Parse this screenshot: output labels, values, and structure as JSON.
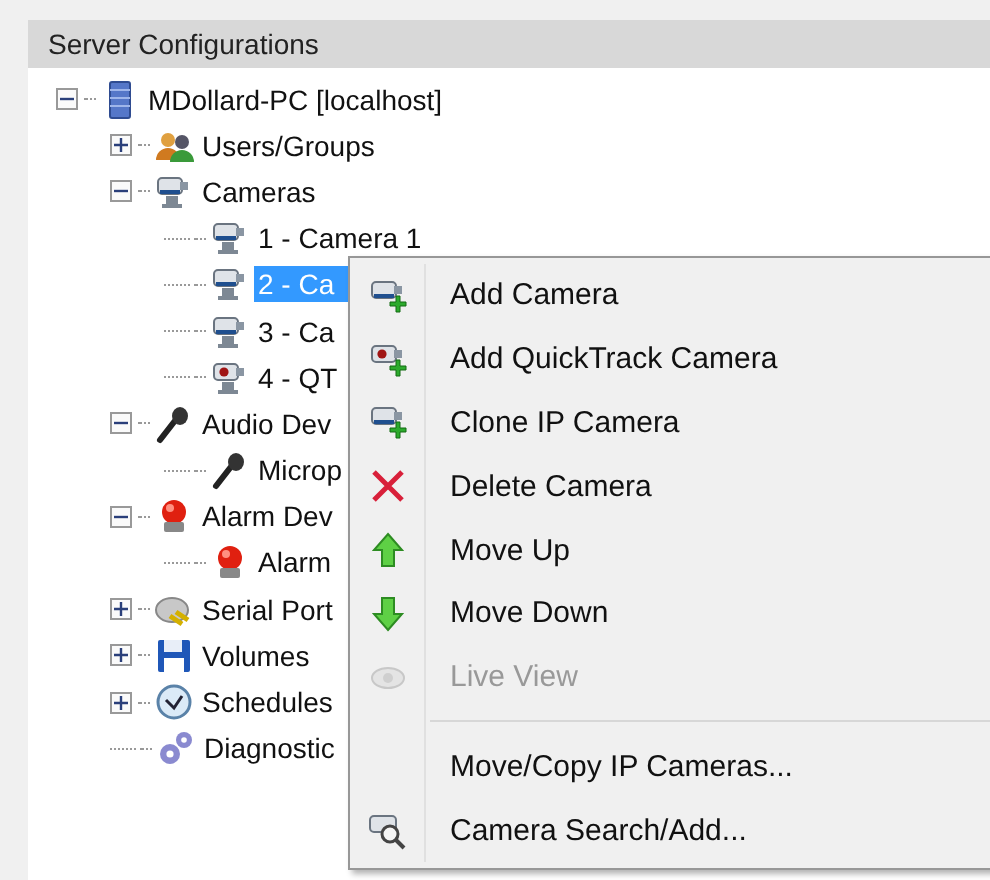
{
  "panel": {
    "title": "Server Configurations"
  },
  "tree": [
    {
      "label": "MDollard-PC [localhost]",
      "kind": "server",
      "expanded": true,
      "selected": false,
      "children": [
        {
          "label": "Users/Groups",
          "kind": "users",
          "expanded": false,
          "selected": false
        },
        {
          "label": "Cameras",
          "kind": "cameras",
          "expanded": true,
          "selected": false,
          "children": [
            {
              "label": "1 - Camera 1",
              "kind": "camera",
              "selected": false
            },
            {
              "label": "2 - Ca",
              "kind": "camera",
              "selected": true
            },
            {
              "label": "3 - Ca",
              "kind": "camera",
              "selected": false
            },
            {
              "label": "4 - QT",
              "kind": "qt-camera",
              "selected": false
            }
          ]
        },
        {
          "label": "Audio Dev",
          "kind": "microphone",
          "expanded": true,
          "selected": false,
          "children": [
            {
              "label": "Microp",
              "kind": "microphone",
              "selected": false
            }
          ]
        },
        {
          "label": "Alarm Dev",
          "kind": "alarm",
          "expanded": true,
          "selected": false,
          "children": [
            {
              "label": "Alarm",
              "kind": "alarm",
              "selected": false
            }
          ]
        },
        {
          "label": "Serial Port",
          "kind": "serial",
          "expanded": false,
          "selected": false
        },
        {
          "label": "Volumes",
          "kind": "volumes",
          "expanded": false,
          "selected": false
        },
        {
          "label": "Schedules",
          "kind": "schedules",
          "expanded": false,
          "selected": false
        },
        {
          "label": "Diagnostic",
          "kind": "diagnostics",
          "selected": false
        }
      ]
    }
  ],
  "context_menu": {
    "items": [
      {
        "kind": "camera-add",
        "label": "Add Camera",
        "disabled": false
      },
      {
        "kind": "qt-add",
        "label": "Add QuickTrack Camera",
        "disabled": false
      },
      {
        "kind": "camera-add",
        "label": "Clone IP Camera",
        "disabled": false
      },
      {
        "kind": "delete",
        "label": "Delete Camera",
        "disabled": false
      },
      {
        "kind": "up",
        "label": "Move Up",
        "disabled": false
      },
      {
        "kind": "down",
        "label": "Move Down",
        "disabled": false
      },
      {
        "kind": "view",
        "label": "Live View",
        "disabled": true
      },
      {
        "kind": "separator"
      },
      {
        "kind": "plain",
        "label": "Move/Copy IP Cameras...",
        "disabled": false
      },
      {
        "kind": "search",
        "label": "Camera Search/Add...",
        "disabled": false
      }
    ]
  }
}
